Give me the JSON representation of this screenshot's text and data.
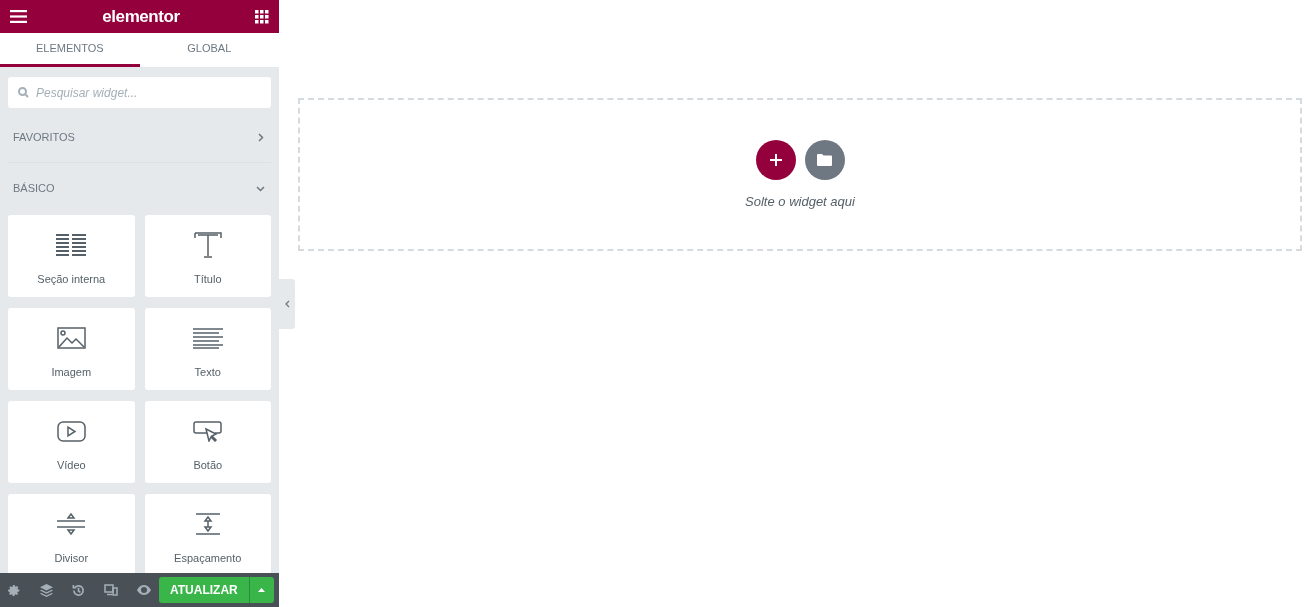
{
  "header": {
    "logo": "elementor"
  },
  "tabs": [
    {
      "label": "ELEMENTOS",
      "selected": true
    },
    {
      "label": "GLOBAL",
      "selected": false
    }
  ],
  "search": {
    "placeholder": "Pesquisar widget..."
  },
  "categories": [
    {
      "label": "FAVORITOS",
      "expanded": false
    },
    {
      "label": "BÁSICO",
      "expanded": true
    }
  ],
  "widgets": [
    {
      "kind": "inner-section",
      "label": "Seção interna"
    },
    {
      "kind": "heading",
      "label": "Título"
    },
    {
      "kind": "image",
      "label": "Imagem"
    },
    {
      "kind": "text",
      "label": "Texto"
    },
    {
      "kind": "video",
      "label": "Vídeo"
    },
    {
      "kind": "button",
      "label": "Botão"
    },
    {
      "kind": "divider",
      "label": "Divisor"
    },
    {
      "kind": "spacer",
      "label": "Espaçamento"
    }
  ],
  "footer": {
    "publish_label": "ATUALIZAR"
  },
  "canvas": {
    "drop_text": "Solte o widget aqui"
  }
}
